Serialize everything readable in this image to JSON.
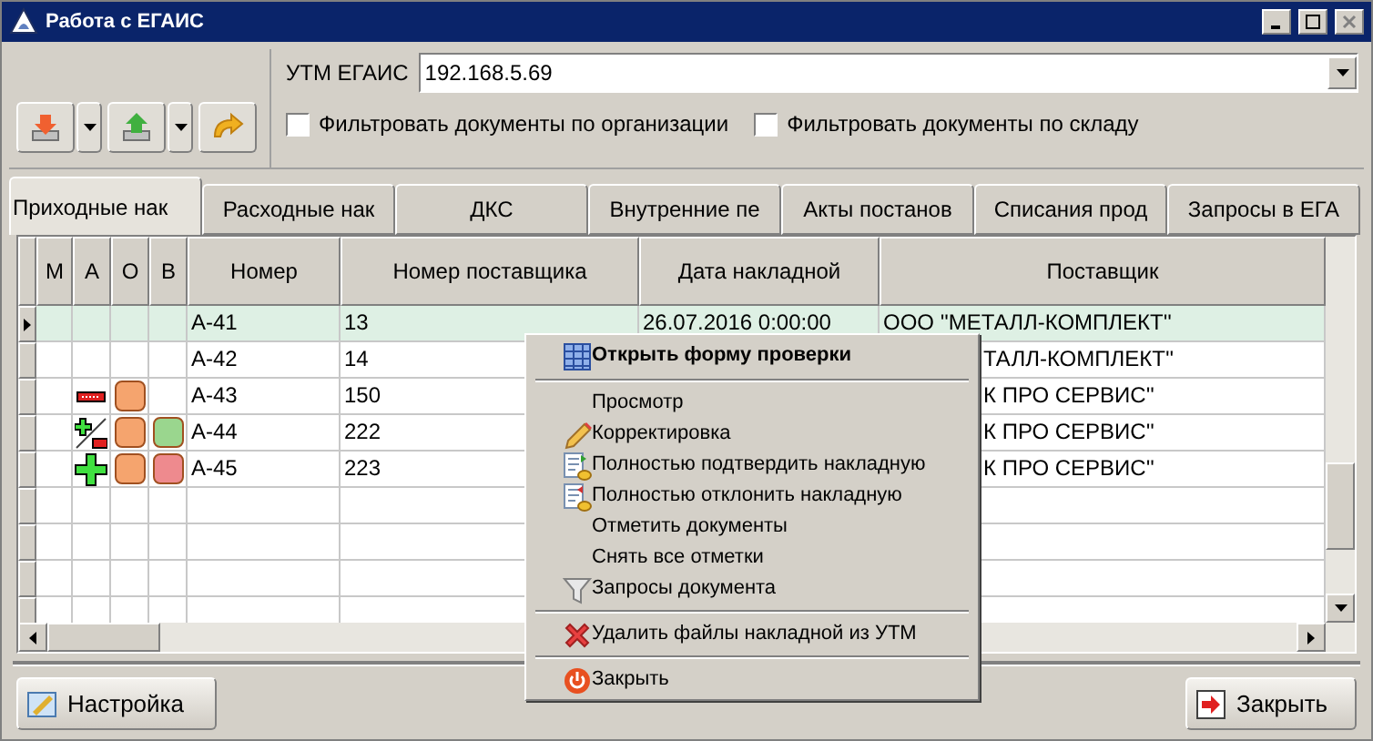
{
  "window": {
    "title": "Работа с ЕГАИС"
  },
  "utm": {
    "label": "УТМ ЕГАИС",
    "value": "192.168.5.69"
  },
  "filters": [
    {
      "label": "Фильтровать документы по организации",
      "checked": false
    },
    {
      "label": "Фильтровать документы по складу",
      "checked": false
    }
  ],
  "tabs": [
    {
      "label": "Приходные нак",
      "selected": true
    },
    {
      "label": "Расходные нак",
      "selected": false
    },
    {
      "label": "ДКС",
      "selected": false
    },
    {
      "label": "Внутренние пе",
      "selected": false
    },
    {
      "label": "Акты постанов",
      "selected": false
    },
    {
      "label": "Списания прод",
      "selected": false
    },
    {
      "label": "Запросы в ЕГА",
      "selected": false
    }
  ],
  "table": {
    "columns": [
      "М",
      "А",
      "О",
      "В",
      "Номер",
      "Номер поставщика",
      "Дата накладной",
      "Поставщик"
    ],
    "rows": [
      {
        "selected": true,
        "number": "А-41",
        "supplier_number": "13",
        "date": "26.07.2016 0:00:00",
        "supplier": "ООО ''МЕТАЛЛ-КОМПЛЕКТ''"
      },
      {
        "selected": false,
        "number": "А-42",
        "supplier_number": "14",
        "supplier": "ТАЛЛ-КОМПЛЕКТ''"
      },
      {
        "selected": false,
        "a": {
          "kind": "minus"
        },
        "o": {
          "color": "#f5a46e"
        },
        "number": "А-43",
        "supplier_number": "150",
        "supplier": "К ПРО СЕРВИС''"
      },
      {
        "selected": false,
        "a": {
          "kind": "mixed"
        },
        "o": {
          "color": "#f5a46e"
        },
        "b": {
          "color": "#9ad68e"
        },
        "number": "А-44",
        "supplier_number": "222",
        "supplier": "К ПРО СЕРВИС''"
      },
      {
        "selected": false,
        "a": {
          "kind": "plus"
        },
        "o": {
          "color": "#f5a46e"
        },
        "b": {
          "color": "#ee8a8e"
        },
        "number": "А-45",
        "supplier_number": "223",
        "supplier": "К ПРО СЕРВИС''"
      }
    ]
  },
  "context_menu": [
    {
      "kind": "item",
      "label": "Открыть форму проверки",
      "default": true
    },
    {
      "kind": "separator"
    },
    {
      "kind": "item",
      "label": "Просмотр",
      "default": false
    },
    {
      "kind": "item",
      "label": "Корректировка",
      "default": false
    },
    {
      "kind": "item",
      "label": "Полностью подтвердить накладную",
      "default": false
    },
    {
      "kind": "item",
      "label": "Полностью отклонить накладную",
      "default": false
    },
    {
      "kind": "item",
      "label": "Отметить документы",
      "default": false
    },
    {
      "kind": "item",
      "label": "Снять все отметки",
      "default": false
    },
    {
      "kind": "item",
      "label": "Запросы документа",
      "default": false
    },
    {
      "kind": "separator"
    },
    {
      "kind": "item",
      "label": "Удалить файлы накладной из УТМ",
      "default": false
    },
    {
      "kind": "separator"
    },
    {
      "kind": "item",
      "label": "Закрыть",
      "default": false
    }
  ],
  "buttons": [
    {
      "label": "Настройка"
    },
    {
      "label": "Закрыть"
    }
  ]
}
